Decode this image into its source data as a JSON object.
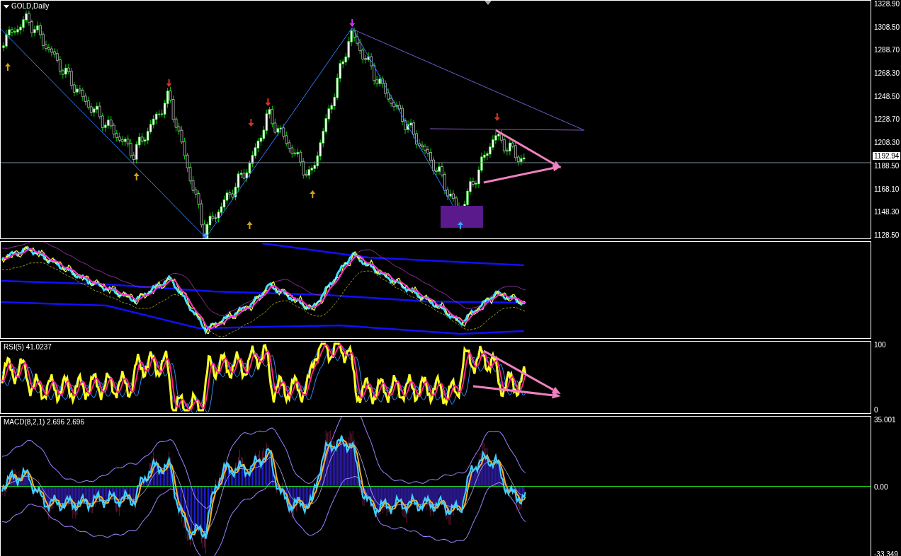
{
  "main_chart": {
    "title": "GOLD,Daily",
    "price_axis": [
      "1328.90",
      "1308.50",
      "1288.70",
      "1268.30",
      "1248.50",
      "1228.70",
      "1208.30",
      "1188.50",
      "1168.10",
      "1148.30",
      "1128.50"
    ],
    "current_price": "1192.94"
  },
  "rsi_pane": {
    "title": "RSI(5) 41.0237",
    "axis": [
      "100",
      "0"
    ]
  },
  "macd_pane": {
    "title": "MACD(8,2,1) 2.696 2.696",
    "axis": [
      "35.001",
      "0.00",
      "-33.349"
    ]
  }
}
